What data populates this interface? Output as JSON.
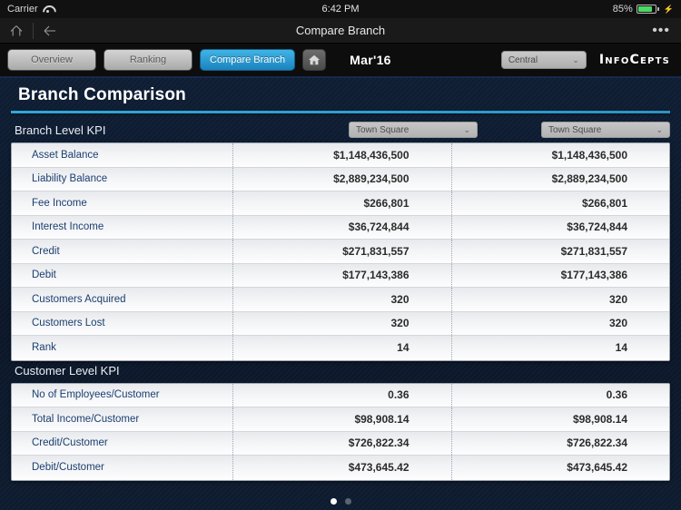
{
  "status_bar": {
    "carrier": "Carrier",
    "wifi_icon": "wifi-icon",
    "time": "6:42 PM",
    "battery_percent": "85%",
    "battery_icon": "battery-icon",
    "charging_icon": "lightning-bolt-icon"
  },
  "nav_bar": {
    "up_icon": "arrow-up-icon",
    "back_icon": "arrow-left-icon",
    "title": "Compare Branch",
    "more_label": "•••"
  },
  "toolbar": {
    "tabs": [
      {
        "label": "Overview",
        "active": false
      },
      {
        "label": "Ranking",
        "active": false
      },
      {
        "label": "Compare Branch",
        "active": true
      }
    ],
    "home_icon": "home-icon",
    "period": "Mar'16",
    "region_select": {
      "value": "Central",
      "chevron": "chevron-down-icon"
    },
    "logo": "InfoCepts",
    "active_color": "#2b9fd6"
  },
  "content": {
    "page_title": "Branch Comparison",
    "accent_color": "#2fa7d8",
    "sections": [
      {
        "label": "Branch Level KPI",
        "select_a": {
          "value": "Town Square",
          "chevron": "chevron-down-icon"
        },
        "select_b": {
          "value": "Town Square",
          "chevron": "chevron-down-icon"
        },
        "rows": [
          {
            "metric": "Asset Balance",
            "value_a": "$1,148,436,500",
            "value_b": "$1,148,436,500"
          },
          {
            "metric": "Liability Balance",
            "value_a": "$2,889,234,500",
            "value_b": "$2,889,234,500"
          },
          {
            "metric": "Fee Income",
            "value_a": "$266,801",
            "value_b": "$266,801"
          },
          {
            "metric": "Interest Income",
            "value_a": "$36,724,844",
            "value_b": "$36,724,844"
          },
          {
            "metric": "Credit",
            "value_a": "$271,831,557",
            "value_b": "$271,831,557"
          },
          {
            "metric": "Debit",
            "value_a": "$177,143,386",
            "value_b": "$177,143,386"
          },
          {
            "metric": "Customers Acquired",
            "value_a": "320",
            "value_b": "320"
          },
          {
            "metric": "Customers Lost",
            "value_a": "320",
            "value_b": "320"
          },
          {
            "metric": "Rank",
            "value_a": "14",
            "value_b": "14"
          }
        ]
      },
      {
        "label": "Customer  Level KPI",
        "rows": [
          {
            "metric": "No of Employees/Customer",
            "value_a": "0.36",
            "value_b": "0.36"
          },
          {
            "metric": "Total Income/Customer",
            "value_a": "$98,908.14",
            "value_b": "$98,908.14"
          },
          {
            "metric": "Credit/Customer",
            "value_a": "$726,822.34",
            "value_b": "$726,822.34"
          },
          {
            "metric": "Debit/Customer",
            "value_a": "$473,645.42",
            "value_b": "$473,645.42"
          }
        ]
      }
    ],
    "pager": {
      "total": 2,
      "active": 1
    }
  }
}
